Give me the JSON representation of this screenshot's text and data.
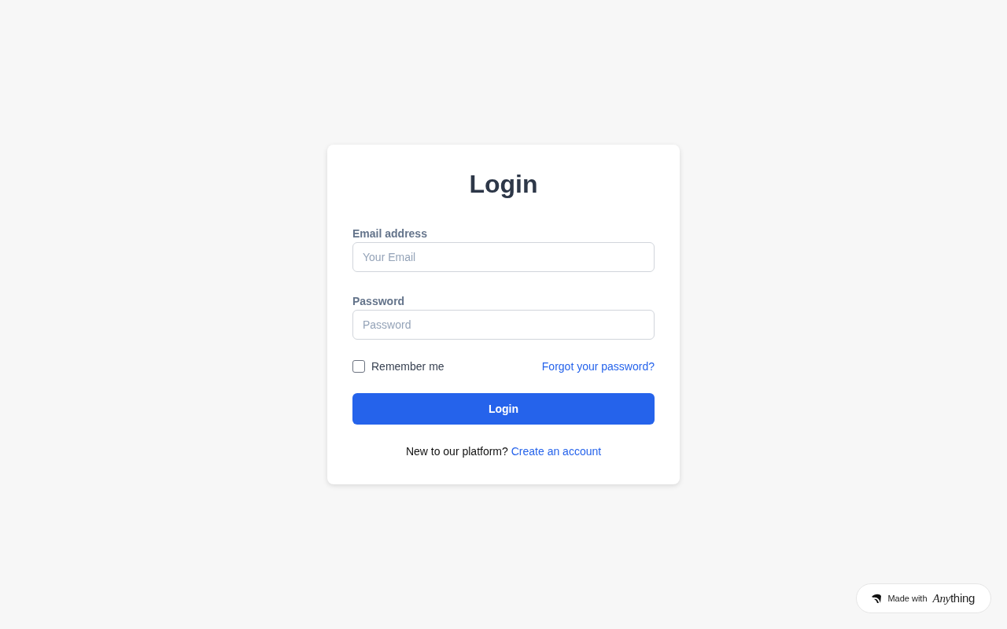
{
  "card": {
    "title": "Login",
    "fields": [
      {
        "label": "Email address",
        "placeholder": "Your Email"
      },
      {
        "label": "Password",
        "placeholder": "Password"
      }
    ],
    "remember": {
      "label": "Remember me",
      "checked": false
    },
    "forgot_link": "Forgot your password?",
    "submit": "Login",
    "footer": {
      "text": "New to our platform?",
      "link": "Create an account"
    }
  },
  "badge": {
    "text": "Made with",
    "logo_italic": "Any",
    "logo_rest": "thing"
  }
}
